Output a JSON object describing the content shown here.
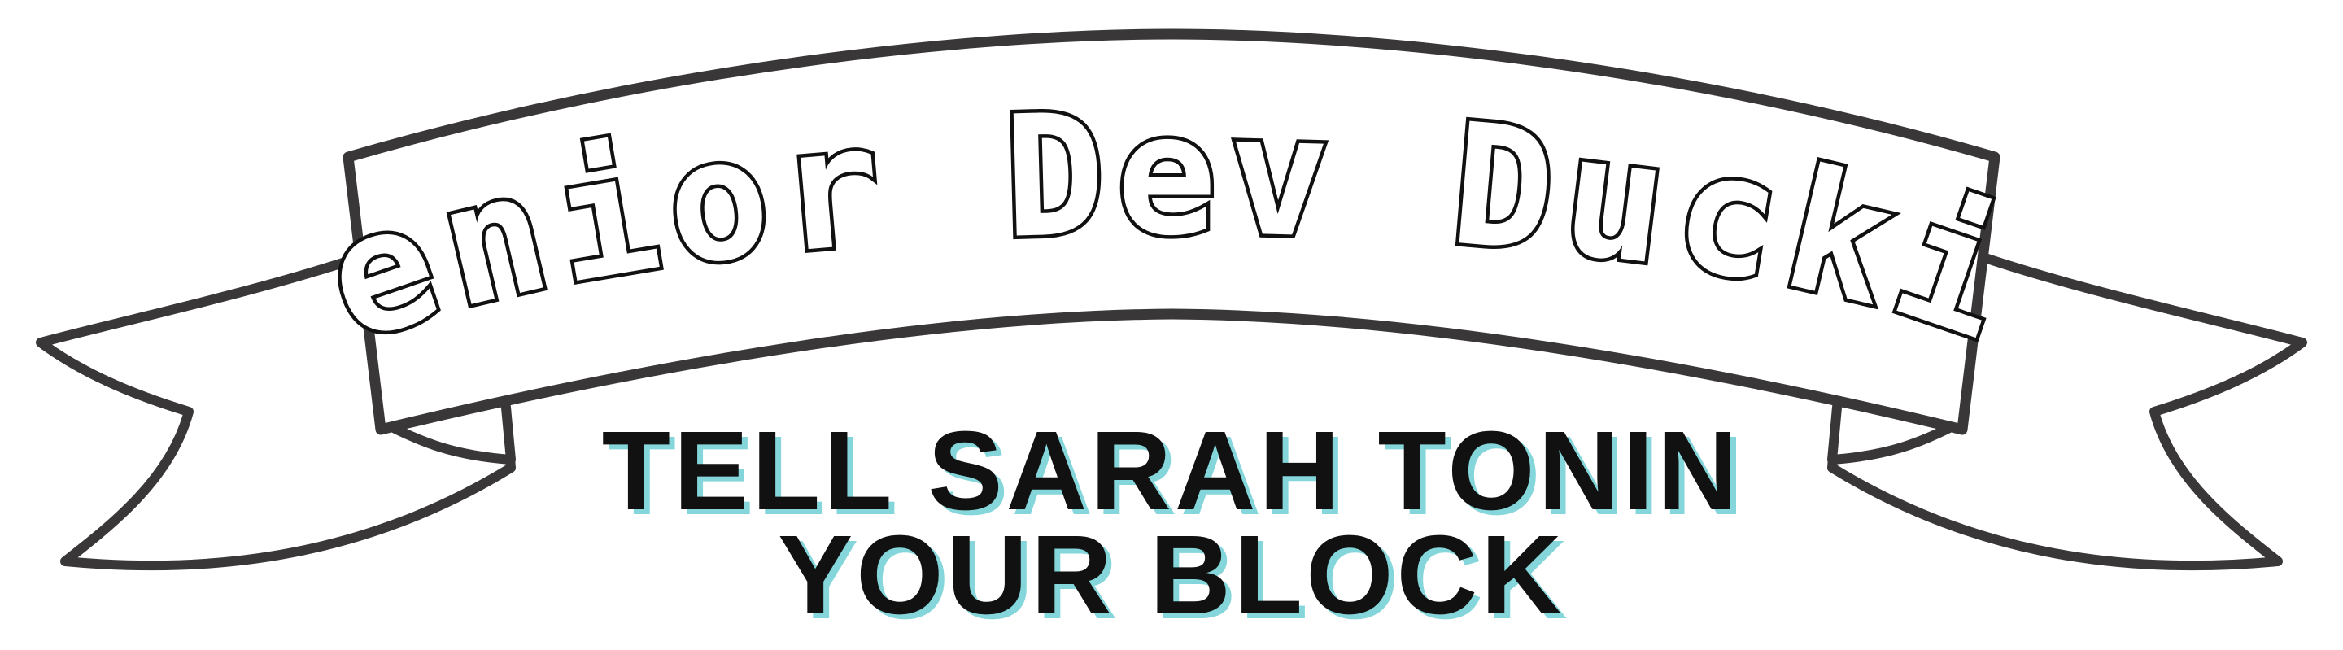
{
  "banner": {
    "title": "Senior Dev Duckie",
    "outline_color": "#3a3738",
    "fill_color": "#ffffff"
  },
  "tagline": {
    "line1": "TELL SARAH TONIN",
    "line2": "YOUR BLOCK",
    "text_color": "#111111",
    "shadow_color": "#84d6da"
  }
}
